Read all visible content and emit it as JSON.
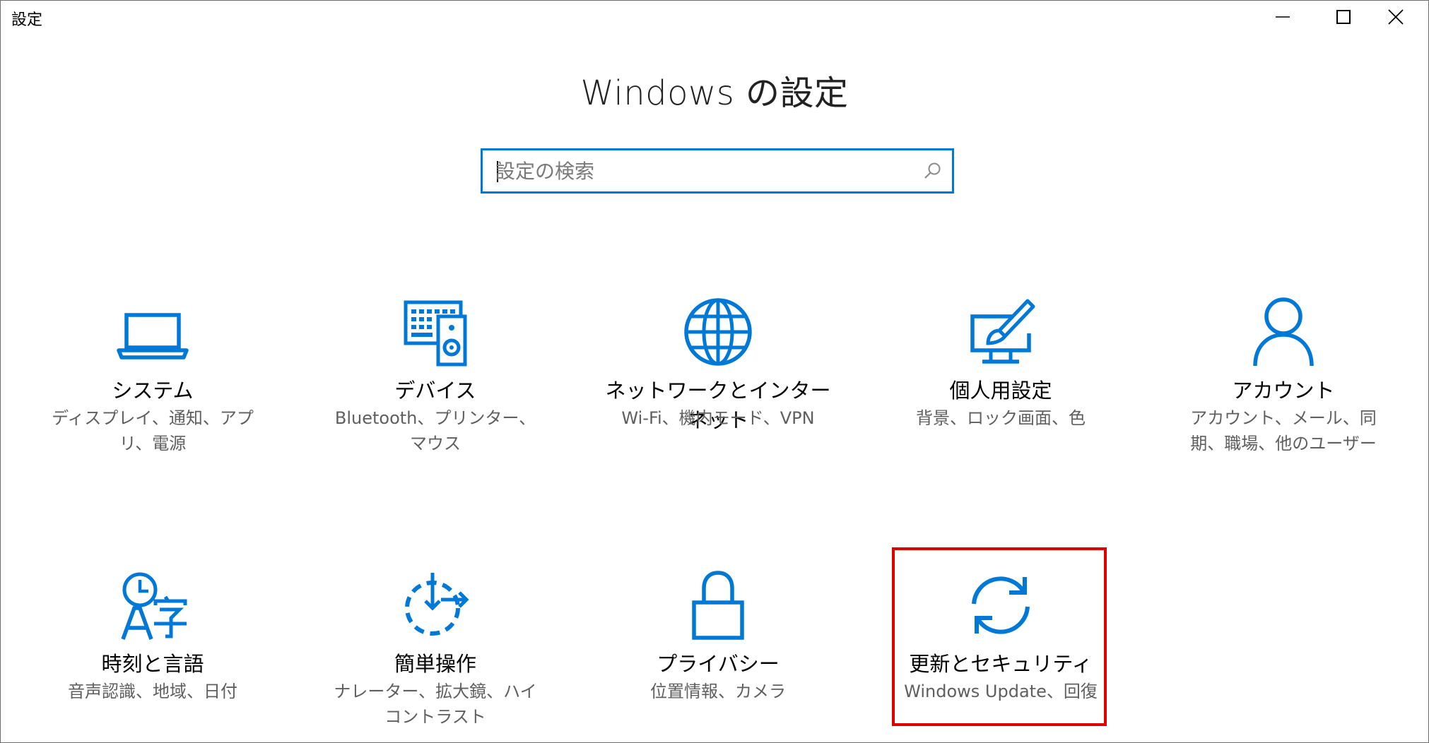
{
  "window": {
    "title": "設定"
  },
  "page": {
    "title": "Windows の設定"
  },
  "search": {
    "placeholder": "設定の検索"
  },
  "colors": {
    "accent": "#0078d7",
    "highlight": "#e00000"
  },
  "tiles": [
    {
      "name": "システム",
      "desc": "ディスプレイ、通知、アプリ、電源",
      "icon": "laptop-icon"
    },
    {
      "name": "デバイス",
      "desc": "Bluetooth、プリンター、マウス",
      "icon": "devices-icon"
    },
    {
      "name": "ネットワークとインターネット",
      "desc": "Wi-Fi、機内モード、VPN",
      "icon": "globe-icon"
    },
    {
      "name": "個人用設定",
      "desc": "背景、ロック画面、色",
      "icon": "personalization-icon"
    },
    {
      "name": "アカウント",
      "desc": "アカウント、メール、同期、職場、他のユーザー",
      "icon": "person-icon"
    },
    {
      "name": "時刻と言語",
      "desc": "音声認識、地域、日付",
      "icon": "time-language-icon"
    },
    {
      "name": "簡単操作",
      "desc": "ナレーター、拡大鏡、ハイコントラスト",
      "icon": "ease-of-access-icon"
    },
    {
      "name": "プライバシー",
      "desc": "位置情報、カメラ",
      "icon": "lock-icon"
    },
    {
      "name": "更新とセキュリティ",
      "desc": "Windows Update、回復",
      "icon": "sync-icon"
    }
  ]
}
